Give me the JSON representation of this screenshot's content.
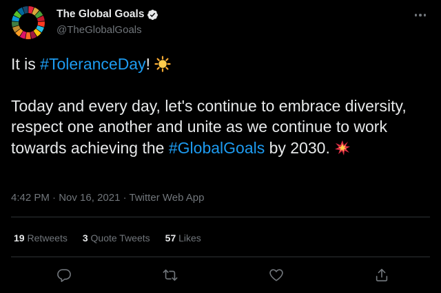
{
  "account": {
    "name": "The Global Goals",
    "handle": "@TheGlobalGoals"
  },
  "tweet": {
    "line1_prefix": "It is ",
    "hashtag1": "#ToleranceDay",
    "line1_suffix": "!",
    "para2_text": "Today and every day, let's continue to embrace diversity, respect one another and unite as we continue to work towards achieving the ",
    "hashtag2": "#GlobalGoals",
    "para2_suffix": " by 2030."
  },
  "meta": {
    "time": "4:42 PM",
    "sep1": " · ",
    "date": "Nov 16, 2021",
    "sep2": " · ",
    "client": "Twitter Web App"
  },
  "stats": {
    "retweets_count": "19",
    "retweets_label": "Retweets",
    "quotes_count": "3",
    "quotes_label": "Quote Tweets",
    "likes_count": "57",
    "likes_label": "Likes"
  },
  "icons": {
    "avatar": "sdg-wheel-avatar",
    "verified": "verified-badge-icon",
    "more": "more-icon",
    "emoji1": "sun-emoji",
    "emoji2": "collision-emoji",
    "reply": "reply-icon",
    "retweet": "retweet-icon",
    "like": "heart-icon",
    "share": "share-icon"
  },
  "colors": {
    "background": "#000000",
    "text": "#e7e9ea",
    "secondary": "#71767b",
    "link": "#1d9bf0",
    "divider": "#2f3336"
  }
}
